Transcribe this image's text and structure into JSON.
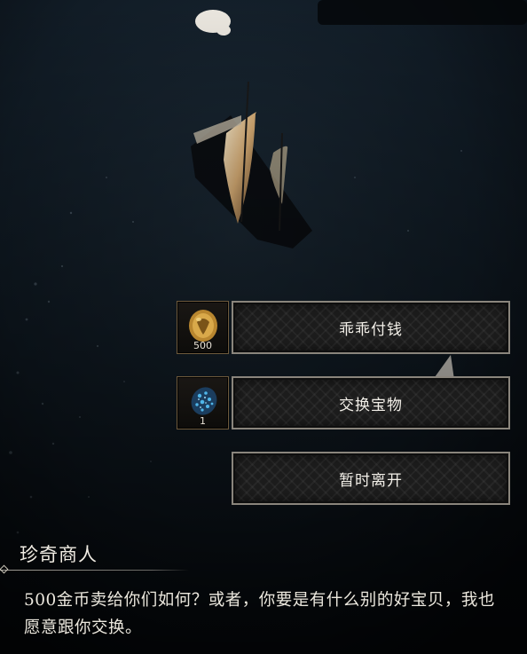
{
  "choices": [
    {
      "item_icon": "gold-coin-icon",
      "item_qty": "500",
      "label": "乖乖付钱"
    },
    {
      "item_icon": "blue-gem-icon",
      "item_qty": "1",
      "label": "交换宝物"
    },
    {
      "label": "暂时离开"
    }
  ],
  "dialog": {
    "speaker": "珍奇商人",
    "text": "500金币卖给你们如何？或者，你要是有什么别的好宝贝，我也愿意跟你交换。"
  },
  "colors": {
    "sea": "#0f1a24",
    "button_border": "#8a857c",
    "slot_border": "#6e5a3c",
    "text": "#ece8de"
  }
}
